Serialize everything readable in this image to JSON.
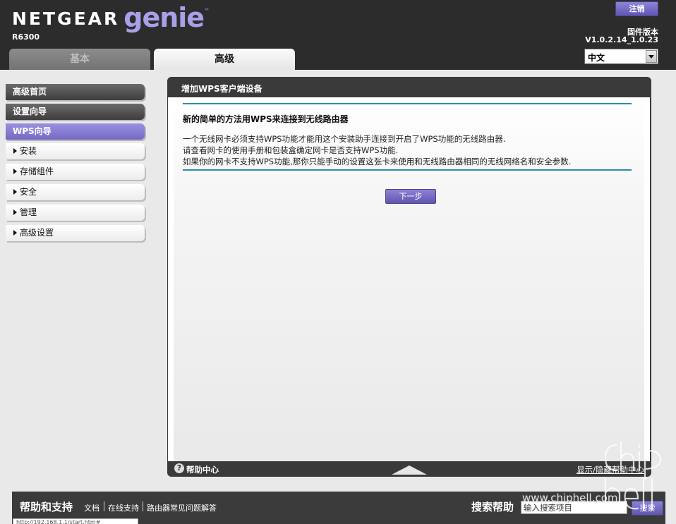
{
  "header": {
    "brand": "NETGEAR",
    "product": "genie",
    "trademark": "™",
    "model": "R6300",
    "logout_label": "注销",
    "firmware_label": "固件版本",
    "firmware_version": "V1.0.2.14_1.0.23",
    "language": "中文",
    "tabs": [
      {
        "label": "基本",
        "active": false
      },
      {
        "label": "高级",
        "active": true
      }
    ]
  },
  "sidebar": {
    "items": [
      {
        "label": "高级首页"
      },
      {
        "label": "设置向导"
      },
      {
        "label": "WPS向导"
      },
      {
        "label": "安装"
      },
      {
        "label": "存储组件"
      },
      {
        "label": "安全"
      },
      {
        "label": "管理"
      },
      {
        "label": "高级设置"
      }
    ]
  },
  "main": {
    "title": "增加WPS客户端设备",
    "subtitle": "新的简单的方法用WPS来连接到无线路由器",
    "lines": [
      "一个无线网卡必须支持WPS功能才能用这个安装助手连接到开启了WPS功能的无线路由器.",
      "请查看网卡的使用手册和包装盒确定网卡是否支持WPS功能.",
      "如果你的网卡不支持WPS功能,那你只能手动的设置这张卡来使用和无线路由器相同的无线网络名和安全参数."
    ],
    "next_label": "下一步"
  },
  "help": {
    "icon": "?",
    "center_label": "帮助中心",
    "toggle_label": "显示/隐藏帮助中心"
  },
  "footer": {
    "title": "帮助和支持",
    "links": [
      "文档",
      "在线支持",
      "路由器常见问题解答"
    ],
    "search_label": "搜索帮助",
    "search_value": "输入搜索项目",
    "search_button": "搜索"
  },
  "statusbar": "http://192.168.1.1/start.htm#",
  "watermark": {
    "url": "www.chiphell.com",
    "logo_top": "chip",
    "logo_bottom": "hell"
  },
  "colors": {
    "accent": "#7a70cc",
    "header_bg": "#2c2c2c",
    "rule": "#2a8fa4"
  }
}
